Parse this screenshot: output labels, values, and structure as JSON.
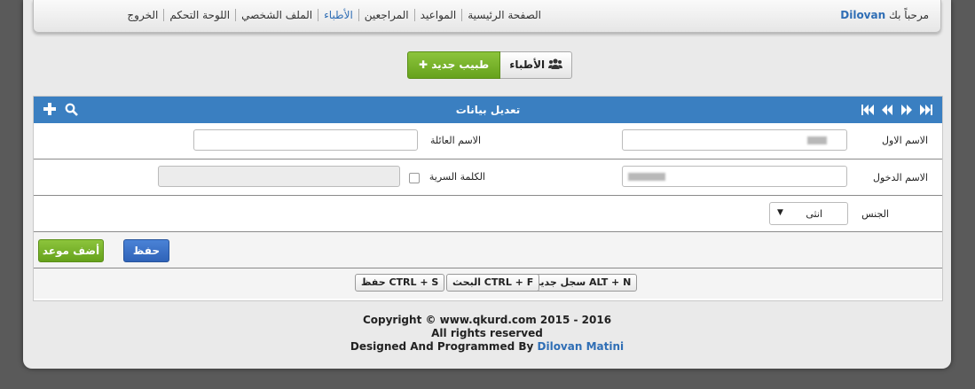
{
  "nav": {
    "welcome_prefix": "مرحباً بك",
    "user": "Dilovan",
    "items": [
      "الصفحة الرئيسية",
      "المواعيد",
      "المراجعين",
      "الأطباء",
      "الملف الشخصي",
      "اللوحة التحكم",
      "الخروج"
    ],
    "active_index": 3
  },
  "toolbar": {
    "doctors_label": "الأطباء",
    "new_doctor_label": "طبيب جديد"
  },
  "panel": {
    "title": "تعديل بيانات",
    "fields": {
      "first_name_label": "الاسم الاول",
      "family_name_label": "الاسم العائلة",
      "family_name_value": "",
      "login_name_label": "الاسم الدخول",
      "password_label": "الكلمة السرية",
      "gender_label": "الجنس",
      "gender_value": "انثى"
    },
    "actions": {
      "save_label": "حفظ",
      "add_appointment_label": "أضف موعد"
    },
    "shortcuts": [
      "ALT + N سجل جديد",
      "CTRL + F البحث",
      "CTRL + S حفظ"
    ]
  },
  "footer": {
    "line1": "Copyright © www.qkurd.com 2015 - 2016",
    "line2": "All rights reserved",
    "line3_prefix": "Designed And Programmed By",
    "line3_link": "Dilovan Matini"
  },
  "colors": {
    "accent_blue": "#3a7fc1",
    "green": "#6aa621",
    "link": "#2f6eb5"
  }
}
